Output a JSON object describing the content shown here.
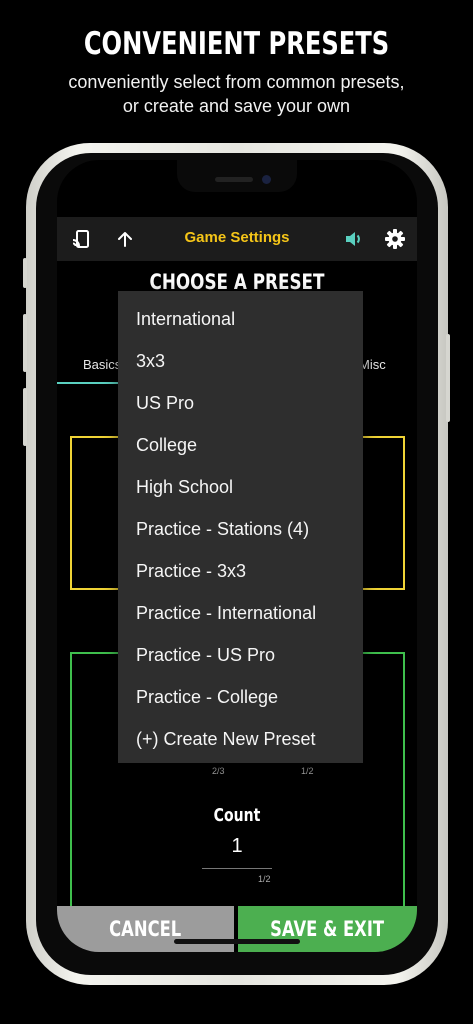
{
  "promo": {
    "headline": "CONVENIENT PRESETS",
    "subtitle_line1": "conveniently select from common presets,",
    "subtitle_line2": "or create and save your own"
  },
  "topbar": {
    "title": "Game Settings",
    "icons": [
      "cast-icon",
      "upload-arrow-icon",
      "volume-icon",
      "settings-gear-icon"
    ],
    "title_color": "#f5c518",
    "volume_icon_color": "#5ad0c0"
  },
  "screen": {
    "heading": "CHOOSE A PRESET",
    "tabs": {
      "basics": "Basics",
      "misc": "Misc"
    },
    "fractions": {
      "left": "2/3",
      "right": "1/2",
      "count_fraction": "1/2"
    },
    "count_label": "Count",
    "count_value": "1"
  },
  "dropdown": {
    "items": [
      "International",
      "3x3",
      "US Pro",
      "College",
      "High School",
      "Practice - Stations (4)",
      "Practice - 3x3",
      "Practice - International",
      "Practice - US Pro",
      "Practice - College",
      "(+) Create New Preset"
    ]
  },
  "buttons": {
    "cancel": "CANCEL",
    "save": "SAVE & EXIT",
    "cancel_color": "#9c9c9c",
    "save_color": "#4caf50"
  }
}
